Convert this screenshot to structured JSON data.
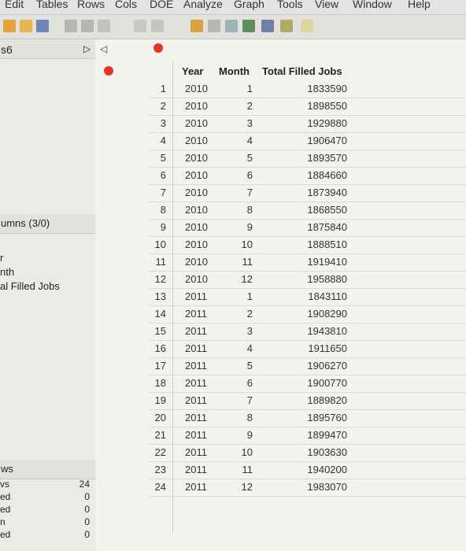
{
  "menubar": [
    "Edit",
    "Tables",
    "Rows",
    "Cols",
    "DOE",
    "Analyze",
    "Graph",
    "Tools",
    "View",
    "Window",
    "Help"
  ],
  "left_panel": {
    "table_name": "s6",
    "columns_header": "umns (3/0)",
    "columns": [
      "r",
      "nth",
      "al Filled Jobs"
    ],
    "rows_header": "ws",
    "rows_labels": [
      "vs",
      "ed",
      "ed",
      "n",
      "ed"
    ],
    "rows_values": [
      "24",
      "0",
      "0",
      "0",
      "0"
    ]
  },
  "table": {
    "headers": [
      "Year",
      "Month",
      "Total Filled Jobs"
    ],
    "rows": [
      [
        "1",
        "2010",
        "1",
        "1833590"
      ],
      [
        "2",
        "2010",
        "2",
        "1898550"
      ],
      [
        "3",
        "2010",
        "3",
        "1929880"
      ],
      [
        "4",
        "2010",
        "4",
        "1906470"
      ],
      [
        "5",
        "2010",
        "5",
        "1893570"
      ],
      [
        "6",
        "2010",
        "6",
        "1884660"
      ],
      [
        "7",
        "2010",
        "7",
        "1873940"
      ],
      [
        "8",
        "2010",
        "8",
        "1868550"
      ],
      [
        "9",
        "2010",
        "9",
        "1875840"
      ],
      [
        "10",
        "2010",
        "10",
        "1888510"
      ],
      [
        "11",
        "2010",
        "11",
        "1919410"
      ],
      [
        "12",
        "2010",
        "12",
        "1958880"
      ],
      [
        "13",
        "2011",
        "1",
        "1843110"
      ],
      [
        "14",
        "2011",
        "2",
        "1908290"
      ],
      [
        "15",
        "2011",
        "3",
        "1943810"
      ],
      [
        "16",
        "2011",
        "4",
        "1911650"
      ],
      [
        "17",
        "2011",
        "5",
        "1906270"
      ],
      [
        "18",
        "2011",
        "6",
        "1900770"
      ],
      [
        "19",
        "2011",
        "7",
        "1889820"
      ],
      [
        "20",
        "2011",
        "8",
        "1895760"
      ],
      [
        "21",
        "2011",
        "9",
        "1899470"
      ],
      [
        "22",
        "2011",
        "10",
        "1903630"
      ],
      [
        "23",
        "2011",
        "11",
        "1940200"
      ],
      [
        "24",
        "2011",
        "12",
        "1983070"
      ]
    ]
  }
}
